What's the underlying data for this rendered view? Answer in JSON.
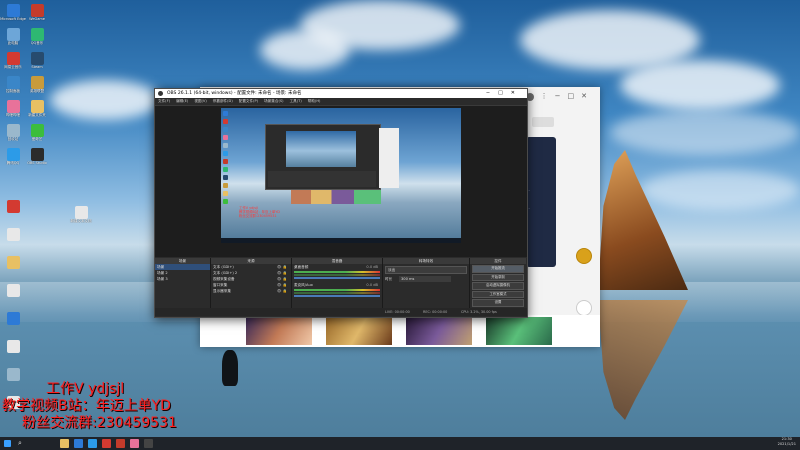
{
  "desktop": {
    "icons_left": [
      {
        "label": "Microsoft Edge",
        "color": "#2d7ad6"
      },
      {
        "label": "此电脑",
        "color": "#6da6d8"
      },
      {
        "label": "网易云音乐",
        "color": "#d33a31"
      },
      {
        "label": "控制面板",
        "color": "#3a86c8"
      },
      {
        "label": "哔哩哔哩",
        "color": "#e8729a"
      },
      {
        "label": "回收站",
        "color": "#9ab8cc"
      },
      {
        "label": "腾讯QQ",
        "color": "#2c9be8"
      },
      {
        "label": "WeGame",
        "color": "#c43b2b"
      },
      {
        "label": "QQ音乐",
        "color": "#2eb872"
      },
      {
        "label": "Steam",
        "color": "#274b6e"
      },
      {
        "label": "英雄联盟",
        "color": "#c89b3c"
      },
      {
        "label": "新建文件夹",
        "color": "#e8c063"
      },
      {
        "label": "爱奇艺",
        "color": "#3cbd3c"
      },
      {
        "label": "OBS Studio",
        "color": "#2b2b2b"
      }
    ],
    "icons_mid": [
      {
        "label": "新建文本文档",
        "color": "#e8e8e8"
      }
    ]
  },
  "background_app": {
    "card_text_1": "...",
    "card_text_2": "..."
  },
  "obs": {
    "title": "OBS 26.1.1 (64-bit, windows) - 配置文件: 未命名 - 场景: 未命名",
    "menu": [
      "文件(F)",
      "编辑(E)",
      "视图(V)",
      "停靠部件(D)",
      "配置文件(P)",
      "场景集合(S)",
      "工具(T)",
      "帮助(H)"
    ],
    "no_source_label": "未选择源",
    "props_label": "属性",
    "filters_label": "滤镜",
    "docks": {
      "scenes": {
        "title": "场景",
        "items": [
          "场景",
          "场景 2",
          "场景 3"
        ],
        "tools": "+ − ∧ ∨"
      },
      "sources": {
        "title": "来源",
        "items": [
          "文本 (GDI+)",
          "文本 (GDI+) 2",
          "视频采集设备",
          "窗口采集",
          "显示器采集"
        ],
        "tools": "+ − ⚙ ∧ ∨"
      },
      "mixer": {
        "title": "混音器",
        "tracks": [
          {
            "name": "桌面音频",
            "level": "0.0 dB"
          },
          {
            "name": "麦克风/Aux",
            "level": "0.0 dB"
          }
        ]
      },
      "transitions": {
        "title": "转场特效",
        "type": "淡出",
        "duration_label": "时长",
        "duration": "300 ms"
      },
      "controls": {
        "title": "控件",
        "buttons": [
          "开始推流",
          "开始录制",
          "启动虚拟摄像机",
          "工作室模式",
          "设置",
          "退出"
        ]
      }
    },
    "status": {
      "live": "LIVE: 00:00:00",
      "rec": "REC: 00:00:00",
      "cpu": "CPU: 3.2%, 30.00 fps"
    }
  },
  "overlay": {
    "line1": "工作V ydjsjl",
    "line2": "教学视频B站：年迈上单YD",
    "line3": "粉丝交流群:230459531"
  },
  "taskbar": {
    "apps": [
      {
        "name": "file-explorer",
        "color": "#e8c063"
      },
      {
        "name": "edge",
        "color": "#2d7ad6"
      },
      {
        "name": "qq",
        "color": "#2c9be8"
      },
      {
        "name": "music",
        "color": "#d33a31"
      },
      {
        "name": "wegame",
        "color": "#c43b2b"
      },
      {
        "name": "bilibili",
        "color": "#e8729a"
      },
      {
        "name": "obs",
        "color": "#444444"
      }
    ],
    "time": "21:30",
    "date": "2021/1/21"
  }
}
